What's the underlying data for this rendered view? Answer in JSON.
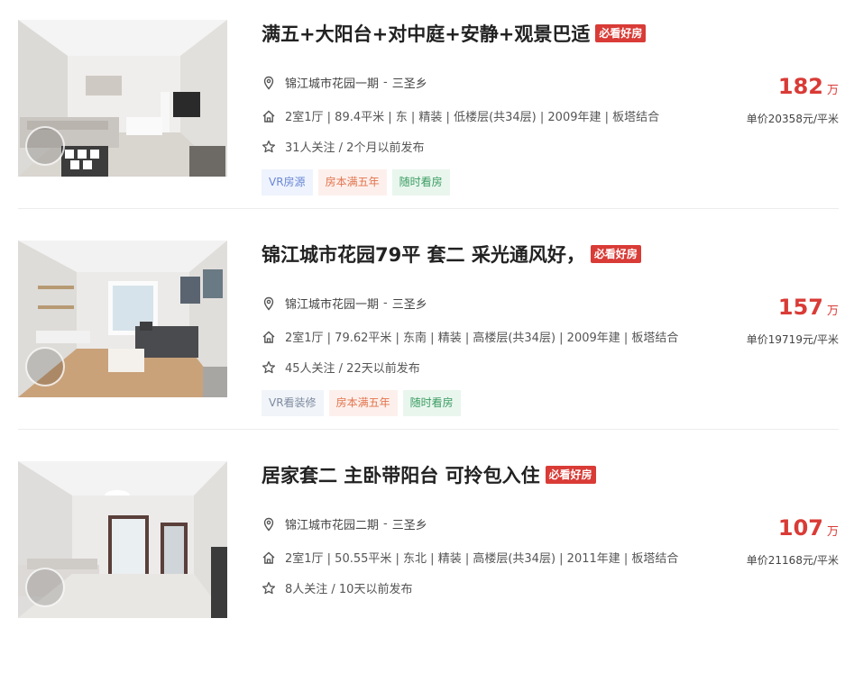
{
  "colors": {
    "accent": "#d93b36",
    "tag_vr": "#6b87d6",
    "tag_five": "#e2734d",
    "tag_anytime": "#3a9c61"
  },
  "listings": [
    {
      "title": "满五+大阳台+对中庭+安静+观景巴适",
      "badge": "必看好房",
      "community": "锦江城市花园一期",
      "separator": "-",
      "district": "三圣乡",
      "house_info": "2室1厅 | 89.4平米 | 东 | 精装 | 低楼层(共34层) | 2009年建 | 板塔结合",
      "follow_info": "31人关注 / 2个月以前发布",
      "tags": [
        "VR房源",
        "房本满五年",
        "随时看房"
      ],
      "total_price": "182",
      "price_unit": "万",
      "unit_price": "单价20358元/平米"
    },
    {
      "title": "锦江城市花园79平 套二 采光通风好，",
      "badge": "必看好房",
      "community": "锦江城市花园一期",
      "separator": "-",
      "district": "三圣乡",
      "house_info": "2室1厅 | 79.62平米 | 东南 | 精装 | 高楼层(共34层) | 2009年建 | 板塔结合",
      "follow_info": "45人关注 / 22天以前发布",
      "tags": [
        "VR看装修",
        "房本满五年",
        "随时看房"
      ],
      "total_price": "157",
      "price_unit": "万",
      "unit_price": "单价19719元/平米"
    },
    {
      "title": "居家套二 主卧带阳台 可拎包入住",
      "badge": "必看好房",
      "community": "锦江城市花园二期",
      "separator": "-",
      "district": "三圣乡",
      "house_info": "2室1厅 | 50.55平米 | 东北 | 精装 | 高楼层(共34层) | 2011年建 | 板塔结合",
      "follow_info": "8人关注 / 10天以前发布",
      "total_price": "107",
      "price_unit": "万",
      "unit_price": "单价21168元/平米"
    }
  ]
}
